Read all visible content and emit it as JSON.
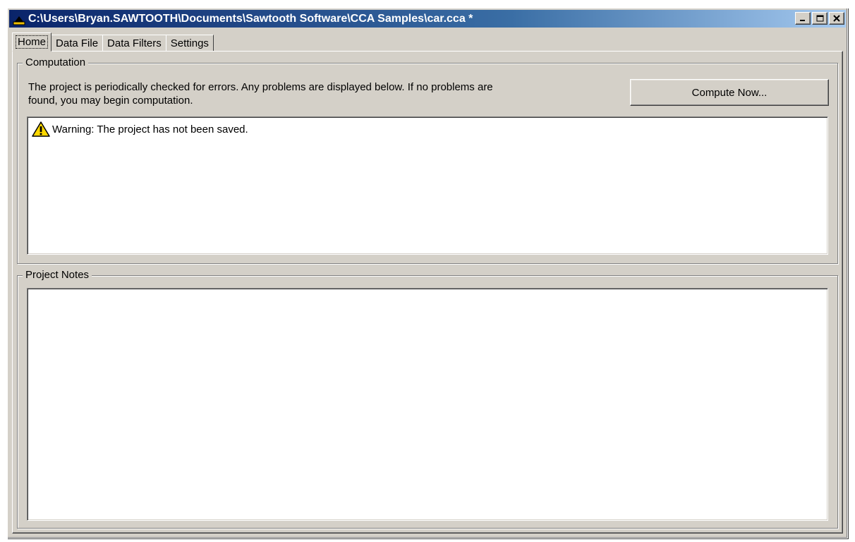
{
  "window": {
    "title": "C:\\Users\\Bryan.SAWTOOTH\\Documents\\Sawtooth Software\\CCA Samples\\car.cca *",
    "app_icon": "sawtooth-app-icon",
    "controls": {
      "minimize": "minimize-icon",
      "maximize": "maximize-icon",
      "close": "close-icon"
    }
  },
  "tabs": [
    {
      "label": "Home",
      "active": true
    },
    {
      "label": "Data File",
      "active": false
    },
    {
      "label": "Data Filters",
      "active": false
    },
    {
      "label": "Settings",
      "active": false
    }
  ],
  "computation": {
    "group_label": "Computation",
    "info_line1": "The project is periodically checked for errors.  Any problems are displayed below.  If no problems are",
    "info_line2": "found, you may begin computation.",
    "compute_button": "Compute Now...",
    "messages": [
      {
        "icon": "warning-icon",
        "text": "Warning: The project has not been saved."
      }
    ]
  },
  "notes": {
    "group_label": "Project Notes",
    "value": ""
  },
  "colors": {
    "title_start": "#0a246a",
    "title_end": "#a6caf0",
    "face": "#d4d0c8",
    "warning": "#ffd800"
  }
}
